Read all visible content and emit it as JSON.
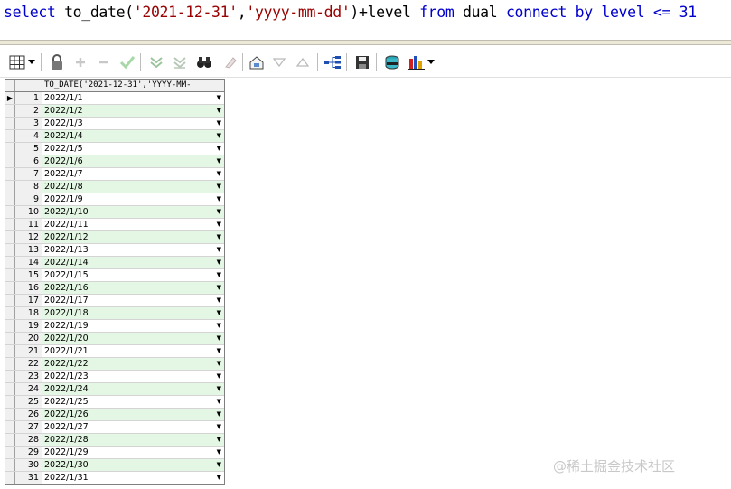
{
  "sql": {
    "tokens": [
      {
        "t": "select",
        "c": "kw"
      },
      {
        "t": " to_date(",
        "c": "txt"
      },
      {
        "t": "'2021-12-31'",
        "c": "str"
      },
      {
        "t": ",",
        "c": "txt"
      },
      {
        "t": "'yyyy-mm-dd'",
        "c": "str"
      },
      {
        "t": ")+level ",
        "c": "txt"
      },
      {
        "t": "from",
        "c": "kw"
      },
      {
        "t": " dual ",
        "c": "txt"
      },
      {
        "t": "connect",
        "c": "kw"
      },
      {
        "t": " ",
        "c": "txt"
      },
      {
        "t": "by",
        "c": "kw"
      },
      {
        "t": " ",
        "c": "txt"
      },
      {
        "t": "level",
        "c": "kw"
      },
      {
        "t": " <= 31",
        "c": "op"
      }
    ]
  },
  "toolbar": {
    "icons": [
      "grid-icon",
      "lock-icon",
      "add-record-icon",
      "delete-record-icon",
      "post-edit-icon",
      "filter-down-icon",
      "filter-clear-icon",
      "find-binoculars-icon",
      "clear-icon",
      "fetch-icon",
      "next-icon",
      "previous-icon",
      "explain-tree-icon",
      "save-icon",
      "export-icon",
      "chart-icon"
    ]
  },
  "grid": {
    "column_header": "TO_DATE('2021-12-31','YYYY-MM-",
    "current_row_marker": "▶",
    "dropdown_glyph": "▼",
    "row_numbers": [
      "1",
      "2",
      "3",
      "4",
      "5",
      "6",
      "7",
      "8",
      "9",
      "10",
      "11",
      "12",
      "13",
      "14",
      "15",
      "16",
      "17",
      "18",
      "19",
      "20",
      "21",
      "22",
      "23",
      "24",
      "25",
      "26",
      "27",
      "28",
      "29",
      "30",
      "31"
    ],
    "rows": [
      "2022/1/1",
      "2022/1/2",
      "2022/1/3",
      "2022/1/4",
      "2022/1/5",
      "2022/1/6",
      "2022/1/7",
      "2022/1/8",
      "2022/1/9",
      "2022/1/10",
      "2022/1/11",
      "2022/1/12",
      "2022/1/13",
      "2022/1/14",
      "2022/1/15",
      "2022/1/16",
      "2022/1/17",
      "2022/1/18",
      "2022/1/19",
      "2022/1/20",
      "2022/1/21",
      "2022/1/22",
      "2022/1/23",
      "2022/1/24",
      "2022/1/25",
      "2022/1/26",
      "2022/1/27",
      "2022/1/28",
      "2022/1/29",
      "2022/1/30",
      "2022/1/31"
    ]
  },
  "watermark": "@稀土掘金技术社区",
  "colors": {
    "keyword": "#0000cc",
    "string": "#990000",
    "row_alt": "#e4f7e4"
  }
}
